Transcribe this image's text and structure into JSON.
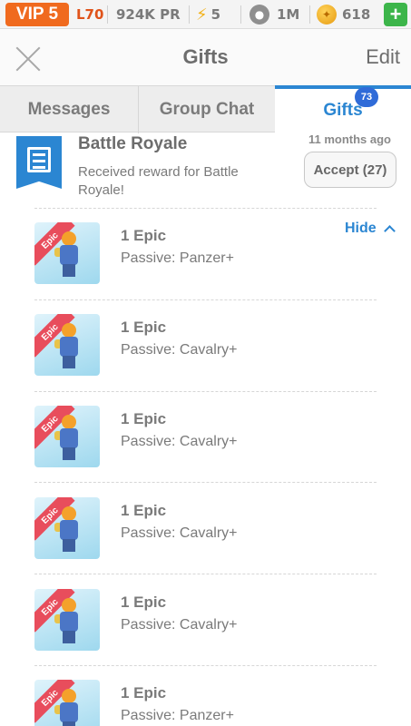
{
  "status_bar": {
    "vip": "VIP 5",
    "level": "L70",
    "power": "924K PR",
    "energy": "5",
    "food": "1M",
    "gold": "618",
    "plus_icon": "plus-icon"
  },
  "nav": {
    "title": "Gifts",
    "edit_label": "Edit",
    "close_icon": "close-icon"
  },
  "tabs": [
    {
      "label": "Messages"
    },
    {
      "label": "Group Chat"
    },
    {
      "label": "Gifts",
      "active": true,
      "badge": "73"
    }
  ],
  "gift_group": {
    "title": "Battle Royale",
    "time": "11 months ago",
    "description": "Received reward for Battle Royale!",
    "accept_label": "Accept (27)",
    "hide_label": "Hide"
  },
  "items": [
    {
      "ribbon": "Epic",
      "title": "1 Epic",
      "subtitle": "Passive: Panzer+"
    },
    {
      "ribbon": "Epic",
      "title": "1 Epic",
      "subtitle": "Passive: Cavalry+"
    },
    {
      "ribbon": "Epic",
      "title": "1 Epic",
      "subtitle": "Passive: Cavalry+"
    },
    {
      "ribbon": "Epic",
      "title": "1 Epic",
      "subtitle": "Passive: Cavalry+"
    },
    {
      "ribbon": "Epic",
      "title": "1 Epic",
      "subtitle": "Passive: Cavalry+"
    },
    {
      "ribbon": "Epic",
      "title": "1 Epic",
      "subtitle": "Passive: Panzer+"
    }
  ],
  "colors": {
    "accent": "#2b86d2",
    "vip": "#f06a1e",
    "ribbon": "#e84d5c",
    "plus": "#3cb54a"
  }
}
